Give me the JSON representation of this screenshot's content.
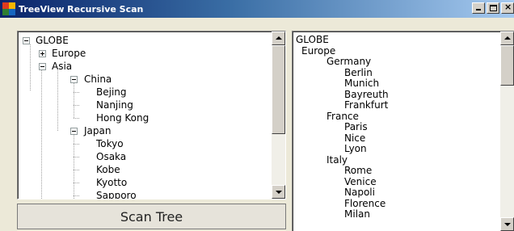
{
  "window": {
    "title": "TreeView Recursive Scan",
    "minimize_icon": "minimize-icon",
    "maximize_icon": "maximize-icon",
    "close_glyph": "×"
  },
  "tree": {
    "nodes": [
      {
        "label": "GLOBE",
        "level": 0,
        "expander": "minus"
      },
      {
        "label": "Europe",
        "level": 1,
        "expander": "plus"
      },
      {
        "label": "Asia",
        "level": 1,
        "expander": "minus"
      },
      {
        "label": "China",
        "level": 2,
        "expander": "minus"
      },
      {
        "label": "Bejing",
        "level": 3,
        "expander": "none"
      },
      {
        "label": "Nanjing",
        "level": 3,
        "expander": "none"
      },
      {
        "label": "Hong Kong",
        "level": 3,
        "expander": "none"
      },
      {
        "label": "Japan",
        "level": 2,
        "expander": "minus"
      },
      {
        "label": "Tokyo",
        "level": 3,
        "expander": "none"
      },
      {
        "label": "Osaka",
        "level": 3,
        "expander": "none"
      },
      {
        "label": "Kobe",
        "level": 3,
        "expander": "none"
      },
      {
        "label": "Kyotto",
        "level": 3,
        "expander": "none"
      },
      {
        "label": "Sapporo",
        "level": 3,
        "expander": "none"
      }
    ]
  },
  "scan_button": {
    "label": "Scan Tree"
  },
  "output": {
    "lines": [
      {
        "text": "GLOBE",
        "indent": 0
      },
      {
        "text": "Europe",
        "indent": 1
      },
      {
        "text": "Germany",
        "indent": 2
      },
      {
        "text": "Berlin",
        "indent": 3
      },
      {
        "text": "Munich",
        "indent": 3
      },
      {
        "text": "Bayreuth",
        "indent": 3
      },
      {
        "text": "Frankfurt",
        "indent": 3
      },
      {
        "text": "France",
        "indent": 2
      },
      {
        "text": "Paris",
        "indent": 3
      },
      {
        "text": "Nice",
        "indent": 3
      },
      {
        "text": "Lyon",
        "indent": 3
      },
      {
        "text": "Italy",
        "indent": 2
      },
      {
        "text": "Rome",
        "indent": 3
      },
      {
        "text": "Venice",
        "indent": 3
      },
      {
        "text": "Napoli",
        "indent": 3
      },
      {
        "text": "Florence",
        "indent": 3
      },
      {
        "text": "Milan",
        "indent": 3
      }
    ]
  },
  "colors": {
    "window_bg": "#ece9d8",
    "titlebar_start": "#0a246a",
    "titlebar_end": "#a6caf0"
  }
}
